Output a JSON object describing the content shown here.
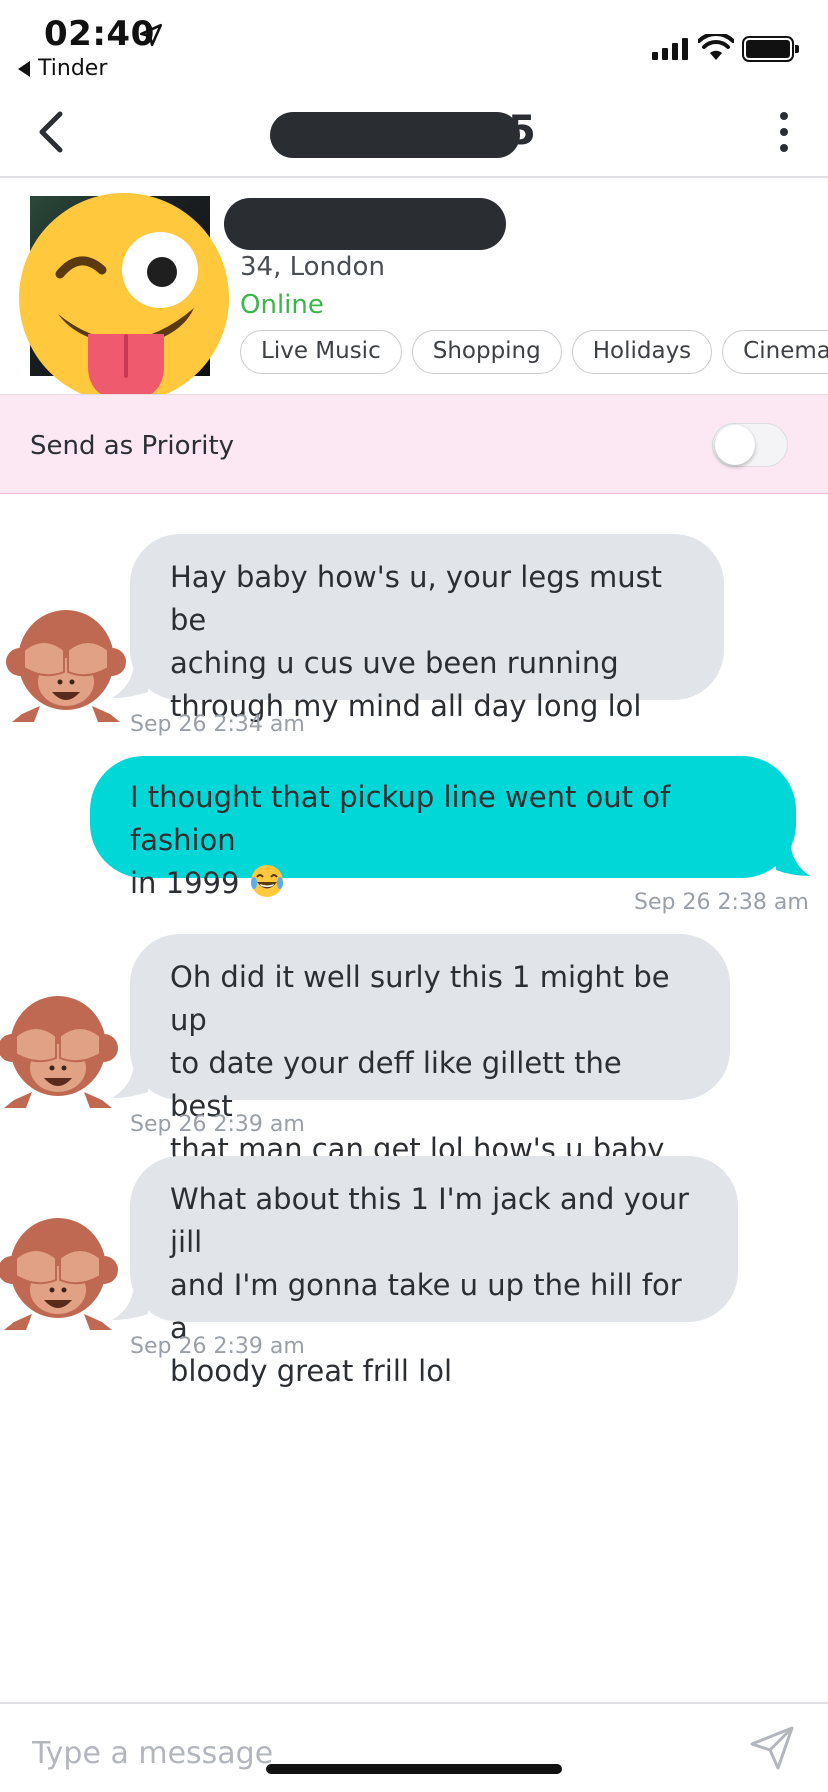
{
  "status_bar": {
    "time": "02:40",
    "back_app_label": "Tinder"
  },
  "header": {
    "name_tail": "5",
    "icons": [
      "chevron-left-icon",
      "more-vertical-icon"
    ]
  },
  "profile": {
    "age_location": "34, London",
    "status": "Online",
    "status_color": "#3cb54a",
    "interests": [
      "Live Music",
      "Shopping",
      "Holidays",
      "Cinema"
    ]
  },
  "priority": {
    "label": "Send as Priority",
    "toggle_on": false,
    "background": "#fce8f3"
  },
  "messages": [
    {
      "direction": "incoming",
      "lines": [
        "Hay baby how's u, your legs must be",
        "aching u cus uve been running",
        "through my mind all day long lol"
      ],
      "timestamp": "Sep 26 2:34 am"
    },
    {
      "direction": "outgoing",
      "lines": [
        "I thought that pickup line went out of fashion",
        "in 1999"
      ],
      "emoji": "face-with-tears-of-joy",
      "timestamp": "Sep 26 2:38 am"
    },
    {
      "direction": "incoming",
      "lines": [
        "Oh did it well surly this 1 might be up",
        "to date your deff like gillett the best",
        "that man can get lol how's u baby"
      ],
      "timestamp": "Sep 26 2:39 am"
    },
    {
      "direction": "incoming",
      "lines": [
        "What about this 1 I'm jack and your jill",
        "and I'm gonna take u up the hill for a",
        "bloody great frill lol"
      ],
      "timestamp": "Sep 26 2:39 am"
    }
  ],
  "colors": {
    "incoming_bubble": "#e1e4e8",
    "outgoing_bubble": "#00d7d6"
  },
  "composer": {
    "placeholder": "Type a message"
  }
}
